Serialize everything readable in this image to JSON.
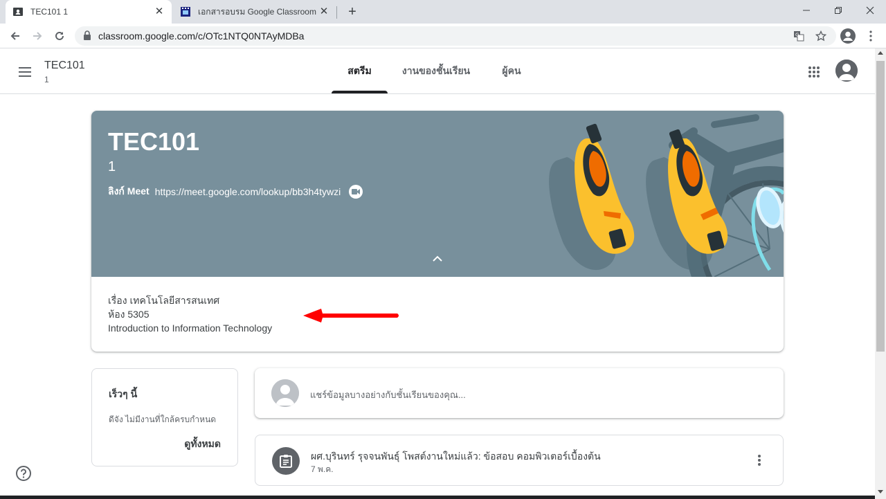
{
  "browser": {
    "tabs": [
      {
        "title": "TEC101 1",
        "active": true,
        "favicon": "classroom-favicon-icon"
      },
      {
        "title": "เอกสารอบรม Google Classroom",
        "active": false,
        "favicon": "film-favicon-icon"
      }
    ],
    "url": "classroom.google.com/c/OTc1NTQ0NTAyMDBa"
  },
  "header": {
    "course_name": "TEC101",
    "course_section": "1",
    "tabs": [
      {
        "label": "สตรีม",
        "active": true
      },
      {
        "label": "งานของชั้นเรียน",
        "active": false
      },
      {
        "label": "ผู้คน",
        "active": false
      }
    ]
  },
  "banner": {
    "title": "TEC101",
    "section": "1",
    "meet_label": "ลิงก์ Meet",
    "meet_link": "https://meet.google.com/lookup/bb3h4tywzi",
    "color": "#78909c"
  },
  "description": {
    "line1": "เรื่อง เทคโนโลยีสารสนเทศ",
    "line2": "ห้อง 5305",
    "line3": "Introduction to Information Technology"
  },
  "upcoming": {
    "title": "เร็วๆ นี้",
    "message": "ดีจัง ไม่มีงานที่ใกล้ครบกำหนด",
    "view_all": "ดูทั้งหมด"
  },
  "share": {
    "placeholder": "แชร์ข้อมูลบางอย่างกับชั้นเรียนของคุณ..."
  },
  "post": {
    "text": "ผศ.บุรินทร์ รุจจนพันธุ์ โพสต์งานใหม่แล้ว: ข้อสอบ คอมพิวเตอร์เบื้องต้น",
    "date": "7 พ.ค."
  }
}
